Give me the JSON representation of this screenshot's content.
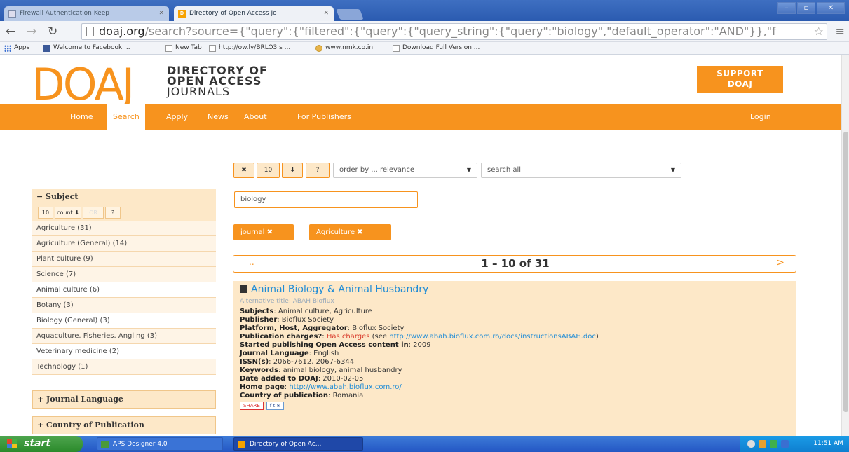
{
  "browser": {
    "tabs": [
      {
        "label": "Firewall Authentication Keep",
        "favicon": "page-icon"
      },
      {
        "label": "Directory of Open Access Jo",
        "favicon": "doaj-icon",
        "favicon_text": "D"
      }
    ],
    "address": {
      "host": "doaj.org",
      "path": "/search?source={\"query\":{\"filtered\":{\"query\":{\"query_string\":{\"query\":\"biology\",\"default_operator\":\"AND\"}},\"f"
    },
    "bookmarks": [
      {
        "label": "Apps",
        "icon": "apps-icon"
      },
      {
        "label": "Welcome to Facebook ...",
        "icon": "facebook-icon"
      },
      {
        "label": "New Tab",
        "icon": "page-icon"
      },
      {
        "label": "http://ow.ly/BRLO3 s ...",
        "icon": "page-icon"
      },
      {
        "label": "www.nmk.co.in",
        "icon": "site-icon"
      },
      {
        "label": "Download Full Version ...",
        "icon": "page-icon"
      }
    ]
  },
  "site": {
    "logo": "DOAJ",
    "logo_sub": [
      "DIRECTORY OF",
      "OPEN ACCESS",
      "JOURNALS"
    ],
    "support": [
      "SUPPORT",
      "DOAJ"
    ],
    "nav": [
      "Home",
      "Search",
      "Apply",
      "News",
      "About",
      "For Publishers"
    ],
    "login": "Login",
    "accent": "#f7931e"
  },
  "controls": {
    "clear": "✖",
    "page_size": "10",
    "sort_dir": "⬇",
    "help": "?",
    "order": "order by ... relevance",
    "scope": "search all",
    "query": "biology"
  },
  "filters": [
    "journal ✖",
    "Agriculture ✖"
  ],
  "pager": {
    "prev": "..",
    "count": "1 – 10 of 31",
    "next": ">"
  },
  "facets": {
    "subject": {
      "title": "− Subject",
      "ctrls": [
        "10",
        "count ⬇",
        "OR",
        "?"
      ],
      "items": [
        "Agriculture (31)",
        "Agriculture (General) (14)",
        "Plant culture (9)",
        "Science (7)",
        "Animal culture (6)",
        "Botany (3)",
        "Biology (General) (3)",
        "Aquaculture. Fisheries. Angling (3)",
        "Veterinary medicine (2)",
        "Technology (1)"
      ]
    },
    "language": "+ Journal Language",
    "country": "+ Country of Publication"
  },
  "result": {
    "title": "Animal Biology & Animal Husbandry",
    "alt": "Alternative title: ABAH Bioflux",
    "subjects_label": "Subjects",
    "subjects": ": Animal culture, Agriculture",
    "publisher_label": "Publisher",
    "publisher": ": Bioflux Society",
    "platform_label": "Platform, Host, Aggregator",
    "platform": ": Bioflux Society",
    "charges_label": "Publication charges?",
    "charges": ": ",
    "charges_value": "Has charges",
    "charges_see": " (see ",
    "charges_link": "http://www.abah.bioflux.com.ro/docs/instructionsABAH.doc",
    "charges_close": ")",
    "started_label": "Started publishing Open Access content in",
    "started": ": 2009",
    "language_label": "Journal Language",
    "language": ": English",
    "issn_label": "ISSN(s)",
    "issn": ": 2066-7612, 2067-6344",
    "keywords_label": "Keywords",
    "keywords": ": animal biology, animal husbandry",
    "added_label": "Date added to DOAJ",
    "added": ": 2010-02-05",
    "home_label": "Home page",
    "home_sep": ": ",
    "home": "http://www.abah.bioflux.com.ro/",
    "country_label": "Country of publication",
    "country": ": Romania",
    "share": "SHARE",
    "share_icons": "f t ✉"
  },
  "taskbar": {
    "start": "start",
    "items": [
      "APS Designer 4.0",
      "Directory of Open Ac..."
    ],
    "clock": "11:51 AM"
  }
}
